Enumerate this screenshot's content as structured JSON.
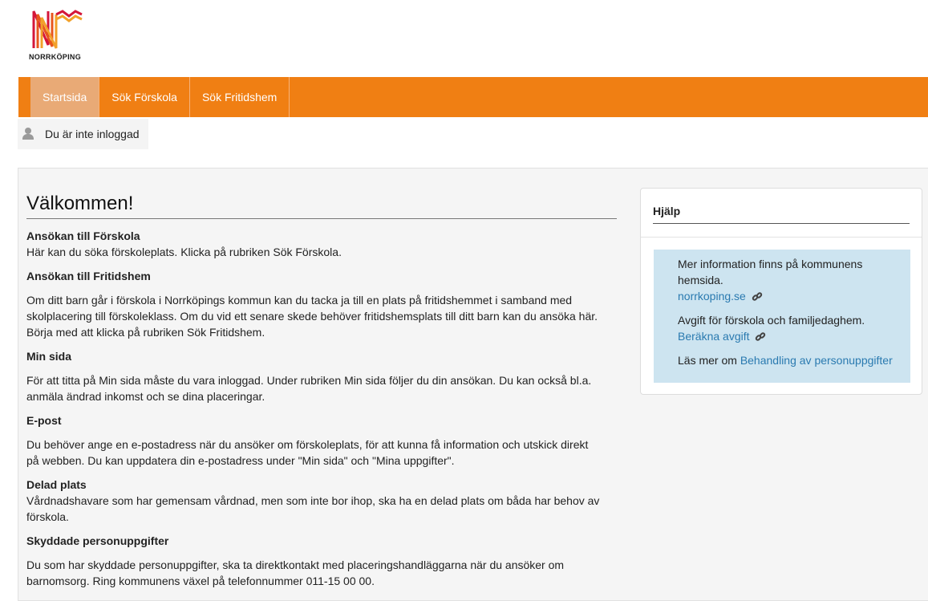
{
  "logo": {
    "text": "NORRKÖPING"
  },
  "nav": {
    "items": [
      {
        "label": "Startsida",
        "active": true
      },
      {
        "label": "Sök Förskola",
        "active": false
      },
      {
        "label": "Sök Fritidshem",
        "active": false
      }
    ]
  },
  "user": {
    "status": "Du är inte inloggad",
    "icon": "user-icon"
  },
  "content": {
    "title": "Välkommen!",
    "sections": [
      {
        "heading": "Ansökan till Förskola",
        "body": [
          "Här kan du söka förskoleplats. Klicka på rubriken Sök Förskola."
        ]
      },
      {
        "heading": "Ansökan till Fritidshem",
        "body": [
          "Om ditt barn går i förskola i Norrköpings kommun kan du tacka ja till en plats på fritidshemmet i samband med",
          "skolplacering till förskoleklass. Om du vid ett senare skede behöver fritidshemsplats till ditt barn kan du ansöka här.",
          "Börja med att klicka på rubriken Sök Fritidshem."
        ]
      },
      {
        "heading": "Min sida",
        "body": [
          "För att titta på Min sida måste du vara inloggad. Under rubriken Min sida följer du din ansökan. Du kan också bl.a.",
          "anmäla ändrad inkomst och se dina placeringar."
        ]
      },
      {
        "heading": "E-post",
        "body": [
          "Du behöver ange en e-postadress när du ansöker om förskoleplats, för att kunna få information och utskick direkt",
          "på webben. Du kan uppdatera din e-postadress under \"Min sida\" och \"Mina uppgifter\"."
        ]
      },
      {
        "heading": "Delad plats",
        "body": [
          "Vårdnadshavare som har gemensam vårdnad, men som inte bor ihop, ska ha en delad plats om båda har behov av",
          "förskola."
        ]
      },
      {
        "heading": "Skyddade personuppgifter",
        "body": [
          "Du som har skyddade personuppgifter, ska ta direktkontakt med placeringshandläggarna när du ansöker om",
          "barnomsorg. Ring kommunens växel på telefonnummer 011-15 00 00."
        ]
      }
    ]
  },
  "help": {
    "title": "Hjälp",
    "info_line1": "Mer information finns på kommunens",
    "info_line2": "hemsida.",
    "site_link": "norrkoping.se",
    "fee_text": "Avgift för förskola och familjedaghem.",
    "fee_link": "Beräkna avgift",
    "read_more_prefix": "Läs mer om ",
    "privacy_link": "Behandling av personuppgifter"
  },
  "colors": {
    "nav": "#f07f13",
    "nav_active": "#e9aa76",
    "help_box": "#cde4f0",
    "link": "#2a7ab0"
  }
}
